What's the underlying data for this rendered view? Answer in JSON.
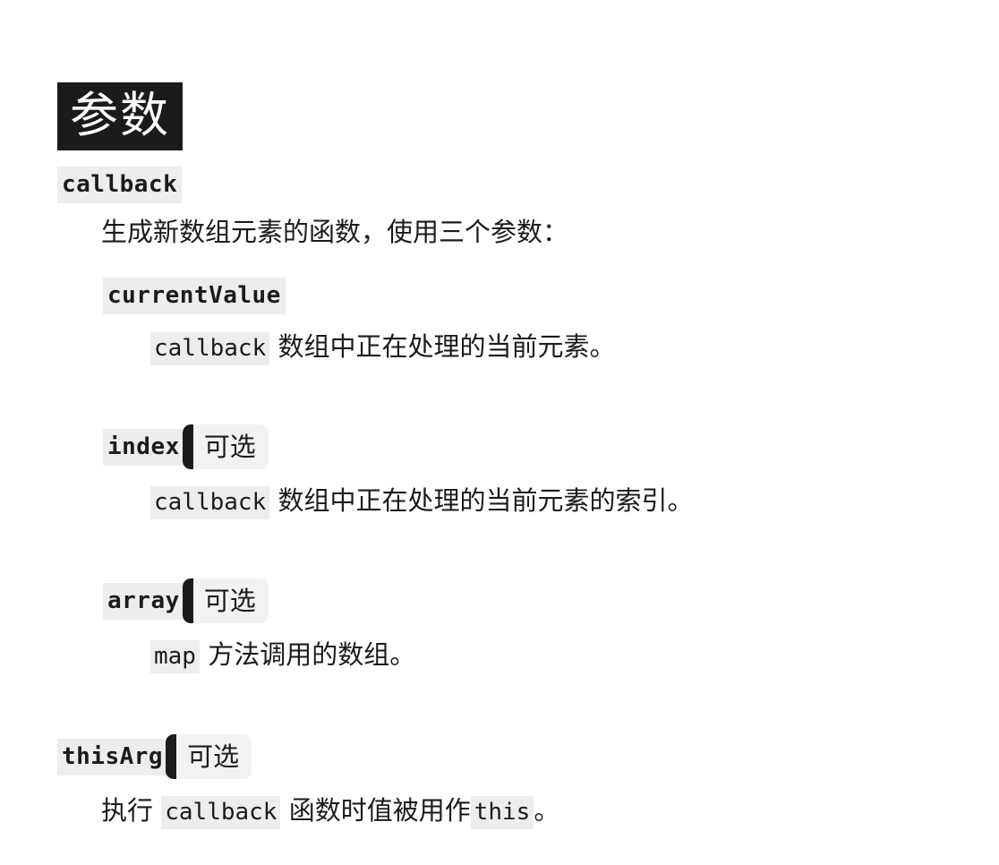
{
  "page": {
    "heading": "参数",
    "optional_badge_label": "可选",
    "colors": {
      "heading_bg": "#1b1b1b",
      "heading_fg": "#ffffff",
      "code_bg": "#ededed",
      "badge_bg": "#f2f2f2",
      "badge_bar": "#1b1b1b",
      "text": "#1b1b1b",
      "page_bg": "#ffffff"
    }
  },
  "parameters": [
    {
      "id": "callback",
      "name": "callback",
      "optional": false,
      "level": 0,
      "description": {
        "prefix": "",
        "code": "",
        "suffix": "生成新数组元素的函数，使用三个参数："
      },
      "children": [
        {
          "id": "currentValue",
          "name": "currentValue",
          "optional": false,
          "level": 1,
          "description": {
            "prefix": "",
            "code": "callback",
            "suffix": "数组中正在处理的当前元素。"
          }
        },
        {
          "id": "index",
          "name": "index",
          "optional": true,
          "level": 1,
          "description": {
            "prefix": "",
            "code": "callback",
            "suffix": "数组中正在处理的当前元素的索引。"
          }
        },
        {
          "id": "array",
          "name": "array",
          "optional": true,
          "level": 1,
          "description": {
            "prefix": "",
            "code": "map",
            "suffix": "方法调用的数组。"
          }
        }
      ]
    },
    {
      "id": "thisArg",
      "name": "thisArg",
      "optional": true,
      "level": 0,
      "description": {
        "prefix": "执行",
        "code": "callback",
        "mid": "函数时值被用作",
        "code2": "this",
        "suffix": "。"
      }
    }
  ]
}
